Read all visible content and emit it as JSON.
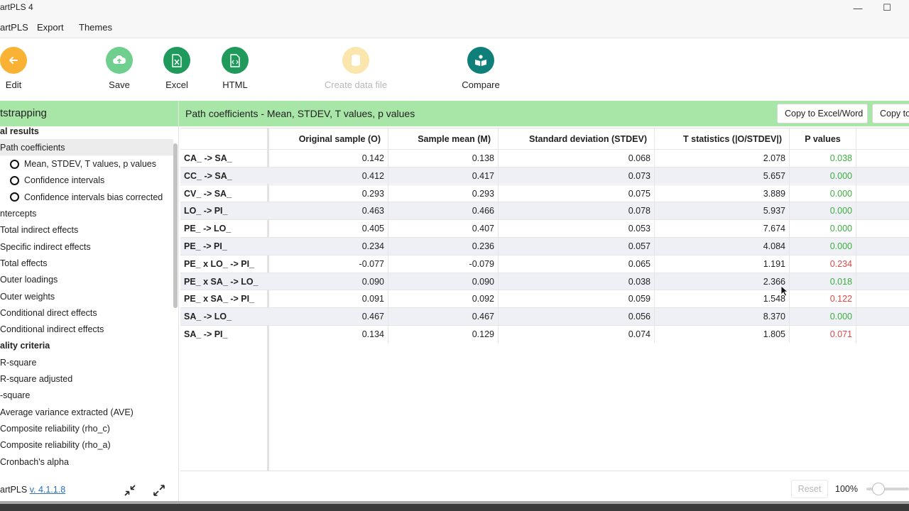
{
  "window": {
    "title": "artPLS 4",
    "minimize_glyph": "—",
    "maximize_glyph": "☐"
  },
  "menu": [
    "artPLS",
    "Export",
    "Themes"
  ],
  "toolbar": {
    "edit": "Edit",
    "save": "Save",
    "excel": "Excel",
    "html": "HTML",
    "create_data_file": "Create data file",
    "compare": "Compare"
  },
  "colors": {
    "accent_green": "#a8e6a8",
    "edit_orange": "#f9b233",
    "save_green": "#6fcf8f",
    "dark_green": "#1f9a5c",
    "disabled_yellow": "#fbe6ae",
    "compare_teal": "#0f7f7a",
    "p_significant": "#3cae3c",
    "p_nonsignificant": "#e04646"
  },
  "sidebar": {
    "header": "tstrapping",
    "items": [
      {
        "label": "al results",
        "level": 0,
        "bold": true
      },
      {
        "label": "Path coefficients",
        "level": 1,
        "selected": true
      },
      {
        "label": "Mean, STDEV, T values, p values",
        "level": 2,
        "radio": true
      },
      {
        "label": "Confidence intervals",
        "level": 2,
        "radio": true
      },
      {
        "label": "Confidence intervals bias corrected",
        "level": 2,
        "radio": true
      },
      {
        "label": "ntercepts",
        "level": 1
      },
      {
        "label": "Total indirect effects",
        "level": 1
      },
      {
        "label": "Specific indirect effects",
        "level": 1
      },
      {
        "label": "Total effects",
        "level": 1
      },
      {
        "label": "Outer loadings",
        "level": 1
      },
      {
        "label": "Outer weights",
        "level": 1
      },
      {
        "label": "Conditional direct effects",
        "level": 1
      },
      {
        "label": "Conditional indirect effects",
        "level": 1
      },
      {
        "label": "ality criteria",
        "level": 0,
        "bold": true
      },
      {
        "label": "R-square",
        "level": 1
      },
      {
        "label": "R-square adjusted",
        "level": 1
      },
      {
        "label": "-square",
        "level": 1
      },
      {
        "label": "Average variance extracted (AVE)",
        "level": 1
      },
      {
        "label": "Composite reliability (rho_c)",
        "level": 1
      },
      {
        "label": "Composite reliability (rho_a)",
        "level": 1
      },
      {
        "label": "Cronbach's alpha",
        "level": 1
      }
    ],
    "version_prefix": "artPLS ",
    "version_link": "v. 4.1.1.8"
  },
  "main": {
    "title": "Path coefficients - Mean, STDEV, T values, p values",
    "copy_excel": "Copy to Excel/Word",
    "copy_other": "Copy to"
  },
  "table": {
    "columns": [
      "Original sample (O)",
      "Sample mean (M)",
      "Standard deviation (STDEV)",
      "T statistics (|O/STDEV|)",
      "P values"
    ],
    "rows": [
      {
        "label": "CA_ -> SA_",
        "values": [
          "0.142",
          "0.138",
          "0.068",
          "2.078",
          "0.038"
        ],
        "sig": true
      },
      {
        "label": "CC_ -> SA_",
        "values": [
          "0.412",
          "0.417",
          "0.073",
          "5.657",
          "0.000"
        ],
        "sig": true
      },
      {
        "label": "CV_ -> SA_",
        "values": [
          "0.293",
          "0.293",
          "0.075",
          "3.889",
          "0.000"
        ],
        "sig": true
      },
      {
        "label": "LO_ -> PI_",
        "values": [
          "0.463",
          "0.466",
          "0.078",
          "5.937",
          "0.000"
        ],
        "sig": true
      },
      {
        "label": "PE_ -> LO_",
        "values": [
          "0.405",
          "0.407",
          "0.053",
          "7.674",
          "0.000"
        ],
        "sig": true
      },
      {
        "label": "PE_ -> PI_",
        "values": [
          "0.234",
          "0.236",
          "0.057",
          "4.084",
          "0.000"
        ],
        "sig": true
      },
      {
        "label": "PE_ x LO_ -> PI_",
        "values": [
          "-0.077",
          "-0.079",
          "0.065",
          "1.191",
          "0.234"
        ],
        "sig": false
      },
      {
        "label": "PE_ x SA_ -> LO_",
        "values": [
          "0.090",
          "0.090",
          "0.038",
          "2.366",
          "0.018"
        ],
        "sig": true
      },
      {
        "label": "PE_ x SA_ -> PI_",
        "values": [
          "0.091",
          "0.092",
          "0.059",
          "1.548",
          "0.122"
        ],
        "sig": false
      },
      {
        "label": "SA_ -> LO_",
        "values": [
          "0.467",
          "0.467",
          "0.056",
          "8.370",
          "0.000"
        ],
        "sig": true
      },
      {
        "label": "SA_ -> PI_",
        "values": [
          "0.134",
          "0.129",
          "0.074",
          "1.805",
          "0.071"
        ],
        "sig": false
      }
    ]
  },
  "zoom": {
    "reset": "Reset",
    "level": "100%",
    "slider_fraction": 0.2
  }
}
